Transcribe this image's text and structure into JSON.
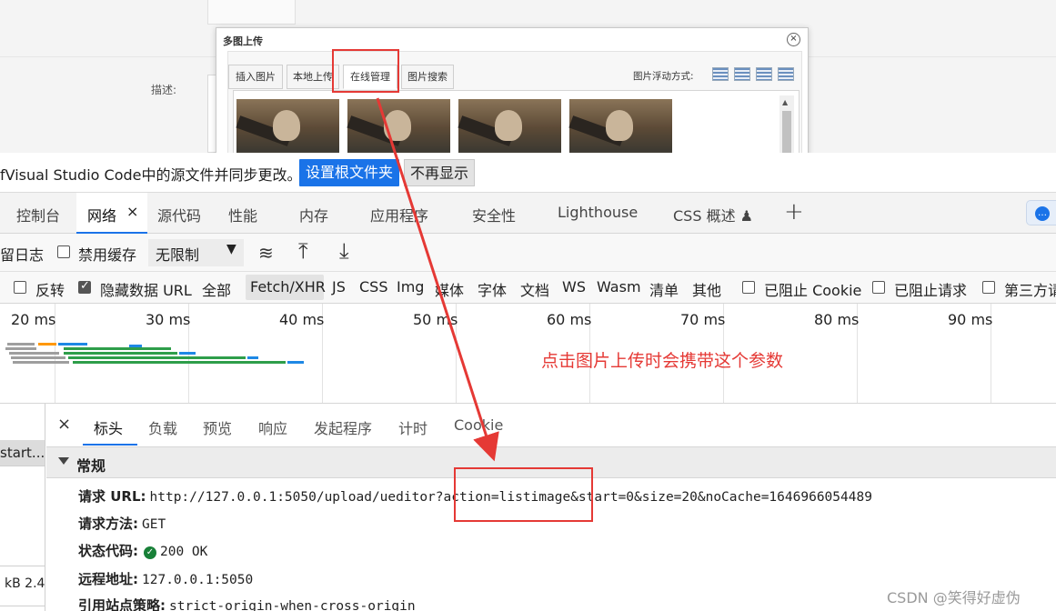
{
  "webpage": {
    "desc_label": "描述:",
    "dialog": {
      "title": "多图上传",
      "close_glyph": "×",
      "tabs": [
        "插入图片",
        "本地上传",
        "在线管理",
        "图片搜索"
      ],
      "float_label": "图片浮动方式:",
      "scroll_up_glyph": "▲"
    }
  },
  "devtools": {
    "banner": {
      "text": "fVisual Studio Code中的源文件并同步更改。",
      "primary_button": "设置根文件夹",
      "secondary_button": "不再显示"
    },
    "tabs": [
      "控制台",
      "网络",
      "源代码",
      "性能",
      "内存",
      "应用程序",
      "安全性",
      "Lighthouse",
      "CSS 概述 ♟"
    ],
    "tab_close_glyph": "×",
    "plus_glyph": "+",
    "feedback_glyph": "…",
    "toolbar": {
      "preserve_log": "留日志",
      "disable_cache": "禁用缓存",
      "disable_cache_checked": false,
      "throttle": "无限制",
      "throttle_arrow": "▼",
      "wifi_glyph": "≋",
      "upload_glyph": "⤒",
      "download_glyph": "⤓"
    },
    "filters": {
      "invert": "反转",
      "invert_checked": false,
      "hide_data_url": "隐藏数据 URL",
      "hide_data_url_checked": true,
      "types": [
        "全部",
        "Fetch/XHR",
        "JS",
        "CSS",
        "Img",
        "媒体",
        "字体",
        "文档",
        "WS",
        "Wasm",
        "清单",
        "其他"
      ],
      "active_type": "Fetch/XHR",
      "blocked_cookies": "已阻止 Cookie",
      "blocked_requests": "已阻止请求",
      "third_party": "第三方请"
    },
    "timeline": {
      "ticks": [
        "20 ms",
        "30 ms",
        "40 ms",
        "50 ms",
        "60 ms",
        "70 ms",
        "80 ms",
        "90 ms"
      ]
    },
    "annotation": "点击图片上传时会携带这个参数",
    "request_list": {
      "selected_name": "start...",
      "size_text": "kB  2.4"
    },
    "detail": {
      "close_glyph": "×",
      "tabs": [
        "标头",
        "负载",
        "预览",
        "响应",
        "发起程序",
        "计时",
        "Cookie"
      ],
      "active_tab": "标头",
      "general_section": "常规",
      "fields": {
        "request_url_label": "请求 URL:",
        "request_url_value": "http://127.0.0.1:5050/upload/ueditor?action=listimage&start=0&size=20&noCache=1646966054489",
        "method_label": "请求方法:",
        "method_value": "GET",
        "status_label": "状态代码:",
        "status_value": "200 OK",
        "status_glyph": "✓",
        "remote_label": "远程地址:",
        "remote_value": "127.0.0.1:5050",
        "referrer_label": "引用站点策略:",
        "referrer_value": "strict-origin-when-cross-origin"
      }
    }
  },
  "watermark": "CSDN @笑得好虚伪",
  "colors": {
    "accent": "#1a73e8",
    "annotation_red": "#e53935",
    "status_ok": "#188038"
  }
}
